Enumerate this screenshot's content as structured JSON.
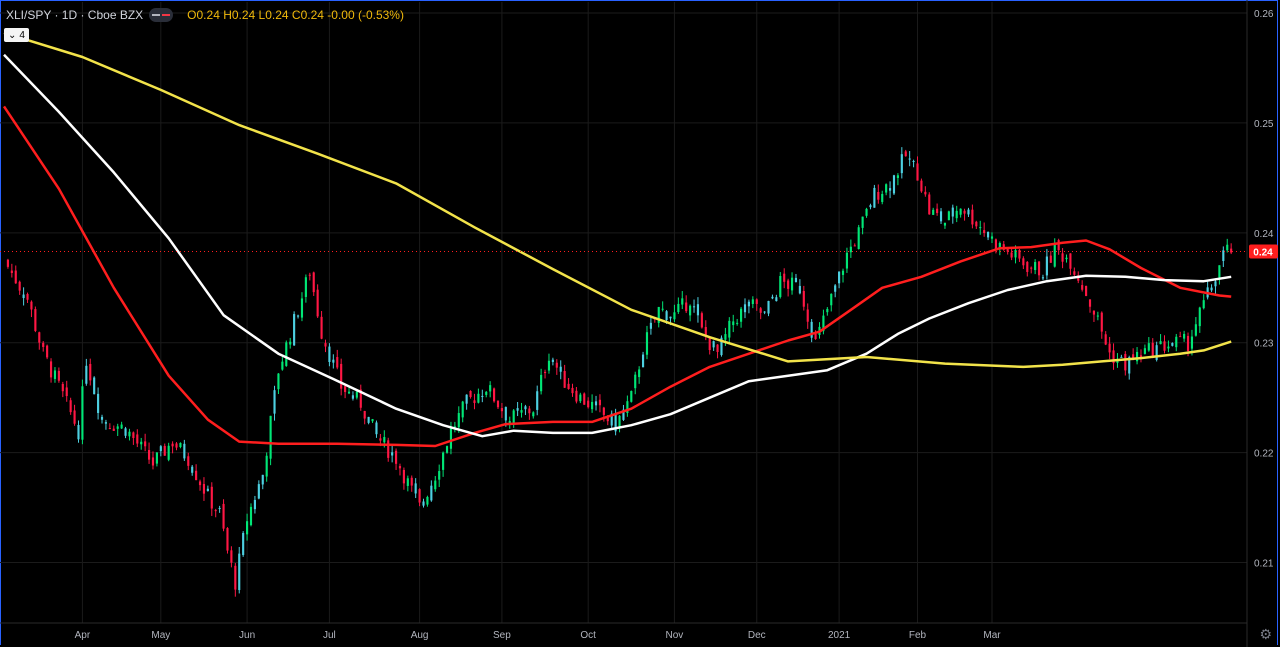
{
  "header": {
    "symbol": "XLI/SPY · 1D · Cboe BZX",
    "ohlc": "O0.24 H0.24 L0.24 C0.24 -0.00 (-0.53%)"
  },
  "study_badge": {
    "chevron": "⌄",
    "count": "4"
  },
  "last_price_label": "0.24",
  "colors": {
    "background": "#000000",
    "up": "#00e676",
    "down": "#ff1744",
    "up_alt": "#4dd0e1",
    "ma_red": "#ff1e1e",
    "ma_white": "#ffffff",
    "ma_yellow": "#f2e34a",
    "grid": "#1b1b1b",
    "price_label_bg": "#ff1e1e"
  },
  "chart_data": {
    "type": "candlestick",
    "x_tick_labels": [
      "Apr",
      "May",
      "Jun",
      "Jul",
      "Aug",
      "Sep",
      "Oct",
      "Nov",
      "Dec",
      "2021",
      "Feb",
      "Mar"
    ],
    "y_tick_labels": [
      "0.26",
      "0.25",
      "0.24",
      "0.23",
      "0.22",
      "0.21"
    ],
    "ylim": [
      0.2045,
      0.261
    ],
    "last_price": 0.2383,
    "close_path": [
      [
        0,
        0.2375
      ],
      [
        6,
        0.234
      ],
      [
        10,
        0.229
      ],
      [
        14,
        0.226
      ],
      [
        19,
        0.222
      ],
      [
        21,
        0.2285
      ],
      [
        25,
        0.223
      ],
      [
        31,
        0.2222
      ],
      [
        38,
        0.219
      ],
      [
        43,
        0.221
      ],
      [
        47,
        0.2195
      ],
      [
        52,
        0.216
      ],
      [
        55,
        0.2145
      ],
      [
        57,
        0.211
      ],
      [
        59,
        0.2082
      ],
      [
        62,
        0.214
      ],
      [
        66,
        0.218
      ],
      [
        70,
        0.2275
      ],
      [
        75,
        0.233
      ],
      [
        78,
        0.2365
      ],
      [
        81,
        0.231
      ],
      [
        86,
        0.226
      ],
      [
        91,
        0.2245
      ],
      [
        95,
        0.2215
      ],
      [
        100,
        0.2195
      ],
      [
        106,
        0.215
      ],
      [
        110,
        0.218
      ],
      [
        114,
        0.222
      ],
      [
        118,
        0.2245
      ],
      [
        123,
        0.226
      ],
      [
        129,
        0.223
      ],
      [
        135,
        0.224
      ],
      [
        139,
        0.229
      ],
      [
        143,
        0.2265
      ],
      [
        147,
        0.225
      ],
      [
        151,
        0.224
      ],
      [
        156,
        0.2225
      ],
      [
        160,
        0.225
      ],
      [
        163,
        0.2295
      ],
      [
        167,
        0.233
      ],
      [
        171,
        0.2325
      ],
      [
        175,
        0.234
      ],
      [
        178,
        0.231
      ],
      [
        182,
        0.229
      ],
      [
        186,
        0.232
      ],
      [
        190,
        0.2335
      ],
      [
        194,
        0.2325
      ],
      [
        198,
        0.2355
      ],
      [
        203,
        0.235
      ],
      [
        207,
        0.23
      ],
      [
        210,
        0.233
      ],
      [
        215,
        0.238
      ],
      [
        218,
        0.24
      ],
      [
        222,
        0.2435
      ],
      [
        226,
        0.2445
      ],
      [
        230,
        0.247
      ],
      [
        233,
        0.2455
      ],
      [
        236,
        0.242
      ],
      [
        240,
        0.241
      ],
      [
        244,
        0.2425
      ],
      [
        248,
        0.241
      ],
      [
        253,
        0.239
      ],
      [
        257,
        0.238
      ],
      [
        261,
        0.237
      ],
      [
        265,
        0.2365
      ],
      [
        268,
        0.2385
      ],
      [
        272,
        0.2375
      ],
      [
        276,
        0.2345
      ],
      [
        279,
        0.232
      ],
      [
        282,
        0.229
      ],
      [
        286,
        0.228
      ],
      [
        290,
        0.229
      ],
      [
        294,
        0.2295
      ],
      [
        298,
        0.23
      ],
      [
        302,
        0.23
      ],
      [
        306,
        0.2335
      ],
      [
        309,
        0.236
      ],
      [
        311,
        0.238
      ],
      [
        313,
        0.2385
      ]
    ],
    "series": [
      {
        "name": "",
        "color_key": "ma_red",
        "points": [
          [
            0,
            0.2515
          ],
          [
            14,
            0.244
          ],
          [
            28,
            0.235
          ],
          [
            42,
            0.227
          ],
          [
            52,
            0.223
          ],
          [
            60,
            0.221
          ],
          [
            70,
            0.2208
          ],
          [
            85,
            0.2208
          ],
          [
            100,
            0.2207
          ],
          [
            110,
            0.2206
          ],
          [
            120,
            0.2218
          ],
          [
            128,
            0.2226
          ],
          [
            140,
            0.2228
          ],
          [
            150,
            0.2228
          ],
          [
            160,
            0.224
          ],
          [
            170,
            0.226
          ],
          [
            180,
            0.2278
          ],
          [
            190,
            0.229
          ],
          [
            200,
            0.2302
          ],
          [
            208,
            0.231
          ],
          [
            216,
            0.233
          ],
          [
            224,
            0.235
          ],
          [
            234,
            0.236
          ],
          [
            244,
            0.2374
          ],
          [
            254,
            0.2386
          ],
          [
            262,
            0.2387
          ],
          [
            270,
            0.2391
          ],
          [
            276,
            0.2393
          ],
          [
            282,
            0.2385
          ],
          [
            290,
            0.2368
          ],
          [
            300,
            0.235
          ],
          [
            310,
            0.2343
          ],
          [
            313,
            0.2342
          ]
        ]
      },
      {
        "name": "",
        "color_key": "ma_white",
        "points": [
          [
            0,
            0.2562
          ],
          [
            14,
            0.251
          ],
          [
            28,
            0.2455
          ],
          [
            42,
            0.2395
          ],
          [
            56,
            0.2325
          ],
          [
            70,
            0.229
          ],
          [
            84,
            0.2267
          ],
          [
            100,
            0.224
          ],
          [
            112,
            0.2225
          ],
          [
            122,
            0.2215
          ],
          [
            130,
            0.222
          ],
          [
            140,
            0.2218
          ],
          [
            150,
            0.2218
          ],
          [
            160,
            0.2225
          ],
          [
            170,
            0.2235
          ],
          [
            180,
            0.225
          ],
          [
            190,
            0.2265
          ],
          [
            200,
            0.227
          ],
          [
            210,
            0.2275
          ],
          [
            220,
            0.229
          ],
          [
            228,
            0.2308
          ],
          [
            236,
            0.2322
          ],
          [
            246,
            0.2336
          ],
          [
            256,
            0.2348
          ],
          [
            266,
            0.2356
          ],
          [
            276,
            0.2361
          ],
          [
            286,
            0.236
          ],
          [
            296,
            0.2357
          ],
          [
            306,
            0.2356
          ],
          [
            313,
            0.236
          ]
        ]
      },
      {
        "name": "",
        "color_key": "ma_yellow",
        "points": [
          [
            0,
            0.2582
          ],
          [
            20,
            0.256
          ],
          [
            40,
            0.253
          ],
          [
            60,
            0.2498
          ],
          [
            80,
            0.2472
          ],
          [
            100,
            0.2445
          ],
          [
            120,
            0.2405
          ],
          [
            140,
            0.2367
          ],
          [
            160,
            0.233
          ],
          [
            180,
            0.2305
          ],
          [
            200,
            0.2283
          ],
          [
            220,
            0.2287
          ],
          [
            240,
            0.2281
          ],
          [
            260,
            0.2278
          ],
          [
            270,
            0.228
          ],
          [
            280,
            0.2283
          ],
          [
            290,
            0.2286
          ],
          [
            300,
            0.229
          ],
          [
            306,
            0.2293
          ],
          [
            313,
            0.2301
          ]
        ]
      }
    ]
  }
}
